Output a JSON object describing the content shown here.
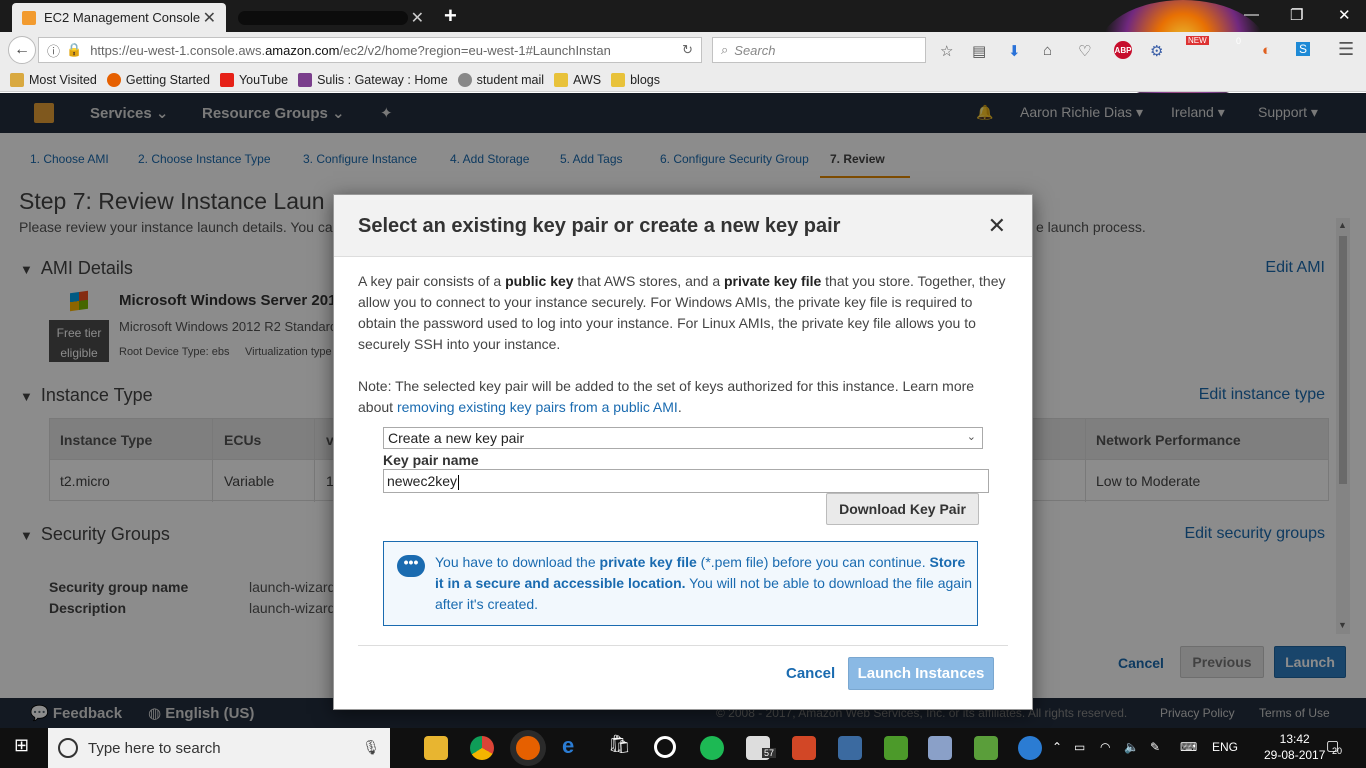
{
  "browser": {
    "active_tab_title": "EC2 Management Console",
    "url_prefix": "https://eu-west-1.console.aws.",
    "url_domain": "amazon.com",
    "url_suffix": "/ec2/v2/home?region=eu-west-1#LaunchInstan",
    "search_placeholder": "Search",
    "bookmarks": [
      "Most Visited",
      "Getting Started",
      "YouTube",
      "Sulis : Gateway : Home",
      "student mail",
      "AWS",
      "blogs"
    ],
    "abp_label": "ABP",
    "new_badge": "NEW",
    "count_badge": "0"
  },
  "aws_header": {
    "services": "Services",
    "resource_groups": "Resource Groups",
    "user": "Aaron Richie Dias",
    "region": "Ireland",
    "support": "Support"
  },
  "wizard": {
    "steps": [
      "1. Choose AMI",
      "2. Choose Instance Type",
      "3. Configure Instance",
      "4. Add Storage",
      "5. Add Tags",
      "6. Configure Security Group",
      "7. Review"
    ],
    "title": "Step 7: Review Instance Laun",
    "subtitle": "Please review your instance launch details. You ca",
    "subtitle_right": "e launch process.",
    "ami_section": "AMI Details",
    "edit_ami": "Edit AMI",
    "ami_name": "Microsoft Windows Server 201",
    "ami_desc": "Microsoft Windows 2012 R2 Standard",
    "ami_root": "Root Device Type: ebs",
    "ami_virt": "Virtualization type",
    "free_tier_1": "Free tier",
    "free_tier_2": "eligible",
    "instance_section": "Instance Type",
    "edit_instance": "Edit instance type",
    "table_headers": [
      "Instance Type",
      "ECUs",
      "v",
      "Network Performance"
    ],
    "table_row": [
      "t2.micro",
      "Variable",
      "1",
      "Low to Moderate"
    ],
    "sg_section": "Security Groups",
    "edit_sg": "Edit security groups",
    "sg_name_label": "Security group name",
    "sg_name_val": "launch-wizard",
    "sg_desc_label": "Description",
    "sg_desc_val": "launch-wizard",
    "cancel": "Cancel",
    "previous": "Previous",
    "launch": "Launch"
  },
  "footer": {
    "feedback": "Feedback",
    "language": "English (US)",
    "copyright": "© 2008 - 2017, Amazon Web Services, Inc. or its affiliates. All rights reserved.",
    "privacy": "Privacy Policy",
    "terms": "Terms of Use"
  },
  "modal": {
    "title": "Select an existing key pair or create a new key pair",
    "p1_a": "A key pair consists of a ",
    "p1_b": "public key",
    "p1_c": " that AWS stores, and a ",
    "p1_d": "private key file",
    "p1_e": " that you store. Together, they allow you to connect to your instance securely. For Windows AMIs, the private key file is required to obtain the password used to log into your instance. For Linux AMIs, the private key file allows you to securely SSH into your instance.",
    "p2_a": "Note: The selected key pair will be added to the set of keys authorized for this instance. Learn more about ",
    "p2_link": "removing existing key pairs from a public AMI",
    "p2_b": ".",
    "select_value": "Create a new key pair",
    "key_label": "Key pair name",
    "key_value": "newec2key",
    "download_btn": "Download Key Pair",
    "info_a": "You have to download the ",
    "info_b": "private key file",
    "info_c": " (*.pem file) before you can continue. ",
    "info_d": "Store it in a secure and accessible location.",
    "info_e": " You will not be able to download the file again after it's created.",
    "cancel": "Cancel",
    "launch": "Launch Instances"
  },
  "taskbar": {
    "search_placeholder": "Type here to search",
    "language": "ENG",
    "time": "13:42",
    "date": "29-08-2017",
    "mail_badge": "57",
    "notif_badge": "20"
  }
}
